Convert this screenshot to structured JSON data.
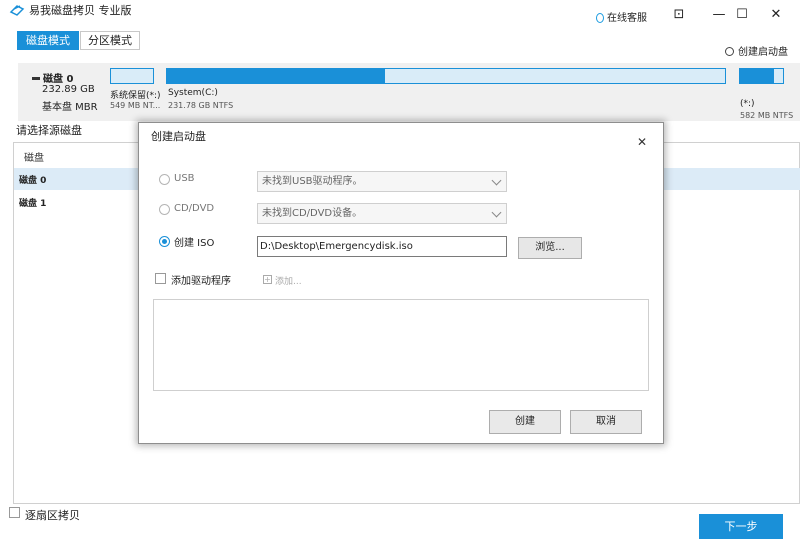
{
  "app": {
    "title": "易我磁盘拷贝 专业版",
    "support_label": "在线客服",
    "window_buttons": {
      "menu": "⊡",
      "minimize": "—",
      "maximize": "☐",
      "close": "✕"
    }
  },
  "tabs": [
    {
      "label": "磁盘模式",
      "active": true
    },
    {
      "label": "分区模式",
      "active": false
    }
  ],
  "toolbar": {
    "create_boot_disk": "创建启动盘"
  },
  "disk": {
    "name": "磁盘 0",
    "size": "232.89 GB",
    "type": "基本盘 MBR",
    "partitions": [
      {
        "name": "系统保留(*:)",
        "info": "549 MB NT...",
        "used_fraction": 0.0
      },
      {
        "name": "System(C:)",
        "info": "231.78 GB NTFS",
        "used_fraction": 0.39
      },
      {
        "name": "(*:)",
        "info": "582 MB NTFS",
        "used_fraction": 0.8
      }
    ]
  },
  "source": {
    "label": "请选择源磁盘",
    "header": "磁盘",
    "rows": [
      "磁盘 0",
      "磁盘 1"
    ]
  },
  "footer": {
    "sector_copy_label": "逐扇区拷贝",
    "next_button": "下一步"
  },
  "dialog": {
    "title": "创建启动盘",
    "close": "✕",
    "options": [
      {
        "label": "USB",
        "value": "未找到USB驱动程序。",
        "selected": false
      },
      {
        "label": "CD/DVD",
        "value": "未找到CD/DVD设备。",
        "selected": false
      },
      {
        "label": "创建 ISO",
        "value": "D:\\Desktop\\Emergencydisk.iso",
        "selected": true
      }
    ],
    "browse_button": "浏览...",
    "add_driver_label": "添加驱动程序",
    "add_label": "添加...",
    "create_button": "创建",
    "cancel_button": "取消"
  },
  "colors": {
    "accent": "#1a90d8",
    "selected_row": "#dcebf7"
  }
}
